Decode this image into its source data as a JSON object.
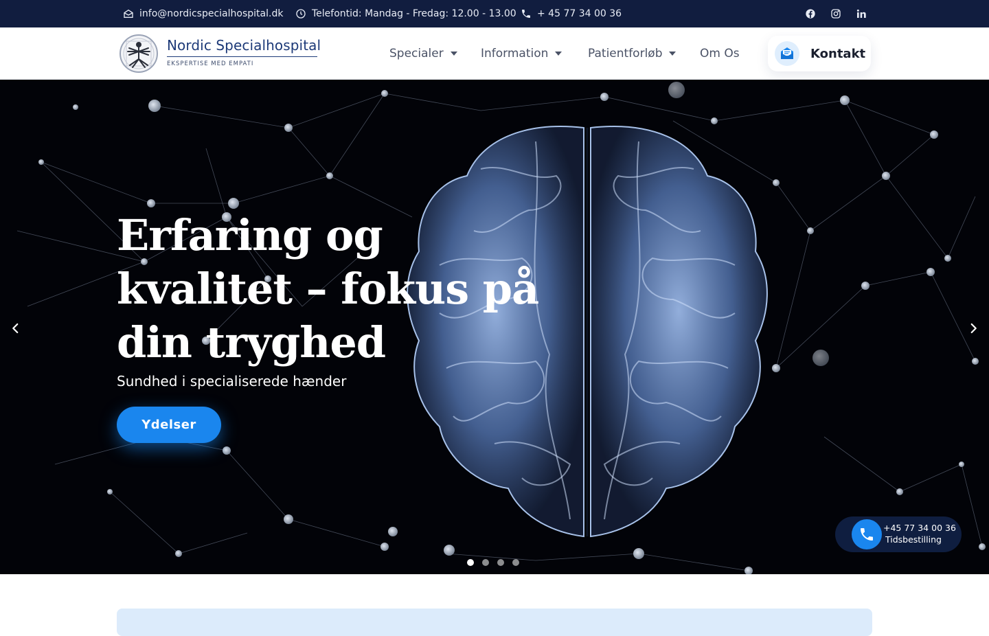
{
  "topbar": {
    "email": "info@nordicspecialhospital.dk",
    "hours": "Telefontid: Mandag - Fredag: 12.00 - 13.00",
    "phone": "+ 45 77 34 00 36",
    "social": [
      "facebook-icon",
      "instagram-icon",
      "linkedin-icon"
    ]
  },
  "header": {
    "logo_name": "Nordic Specialhospital",
    "logo_tagline": "EKSPERTISE MED EMPATI",
    "nav": [
      {
        "label": "Specialer",
        "has_dropdown": true
      },
      {
        "label": "Information",
        "has_dropdown": true
      },
      {
        "label": "Patientforløb",
        "has_dropdown": true
      },
      {
        "label": "Om Os",
        "has_dropdown": false
      }
    ],
    "contact_label": "Kontakt"
  },
  "hero": {
    "title": "Erfaring og kvalitet – fokus på din tryghed",
    "subtitle": "Sundhed i specialiserede hænder",
    "button_label": "Ydelser",
    "slides_total": 4,
    "active_slide": 1
  },
  "call_widget": {
    "number": "+45 77 34 00 36",
    "label": "Tidsbestilling"
  },
  "colors": {
    "topbar_bg": "#111d3f",
    "brand_blue": "#1d3a78",
    "accent": "#1a86ee",
    "call_widget_bg": "#0f1e40"
  }
}
